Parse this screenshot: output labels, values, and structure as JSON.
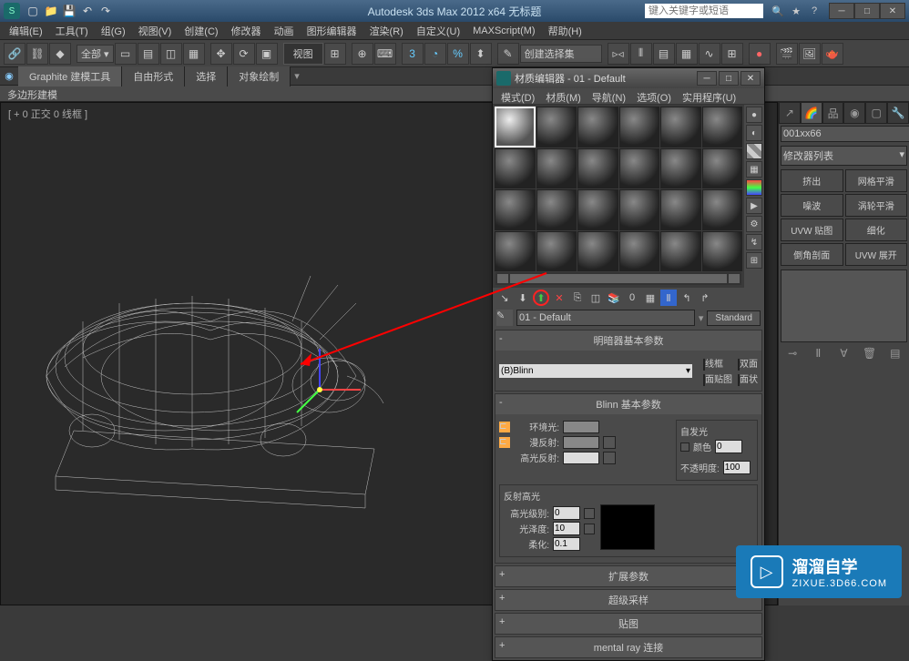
{
  "titlebar": {
    "title": "Autodesk 3ds Max  2012 x64    无标题",
    "search_placeholder": "键入关键字或短语"
  },
  "menu": [
    "编辑(E)",
    "工具(T)",
    "组(G)",
    "视图(V)",
    "创建(C)",
    "修改器",
    "动画",
    "图形编辑器",
    "渲染(R)",
    "自定义(U)",
    "MAXScript(M)",
    "帮助(H)"
  ],
  "toolbar": {
    "view_label": "视图",
    "create_dropdown": "创建选择集"
  },
  "ribbon": {
    "tabs": [
      "Graphite 建模工具",
      "自由形式",
      "选择",
      "对象绘制"
    ],
    "sub": "多边形建模"
  },
  "viewport": {
    "label": "[ + 0 正交 0 线框 ]"
  },
  "cmdpanel": {
    "objname": "001xx66",
    "modlist": "修改器列表",
    "buttons": [
      "挤出",
      "网格平滑",
      "噪波",
      "涡轮平滑",
      "UVW 贴图",
      "细化",
      "倒角剖面",
      "UVW 展开"
    ]
  },
  "mateditor": {
    "title": "材质编辑器 - 01 - Default",
    "menu": [
      "模式(D)",
      "材质(M)",
      "导航(N)",
      "选项(O)",
      "实用程序(U)"
    ],
    "matname": "01 - Default",
    "type_btn": "Standard",
    "rollouts": {
      "shader_params": "明暗器基本参数",
      "shader": "(B)Blinn",
      "wire": "线框",
      "twosided": "双面",
      "facemap": "面贴图",
      "faceted": "面状",
      "blinn_params": "Blinn 基本参数",
      "ambient": "环境光:",
      "diffuse": "漫反射:",
      "specular": "高光反射:",
      "selfgroup": "自发光",
      "selfcolor": "颜色",
      "selfval": "0",
      "opacity": "不透明度:",
      "opval": "100",
      "spechigh": "反射高光",
      "speclevel": "高光级别:",
      "specval": "0",
      "gloss": "光泽度:",
      "glossval": "10",
      "soften": "柔化:",
      "softenval": "0.1",
      "ext": "扩展参数",
      "ss": "超级采样",
      "maps": "贴图",
      "mental": "mental ray 连接"
    }
  },
  "watermark": {
    "name": "溜溜自学",
    "url": "ZIXUE.3D66.COM"
  }
}
